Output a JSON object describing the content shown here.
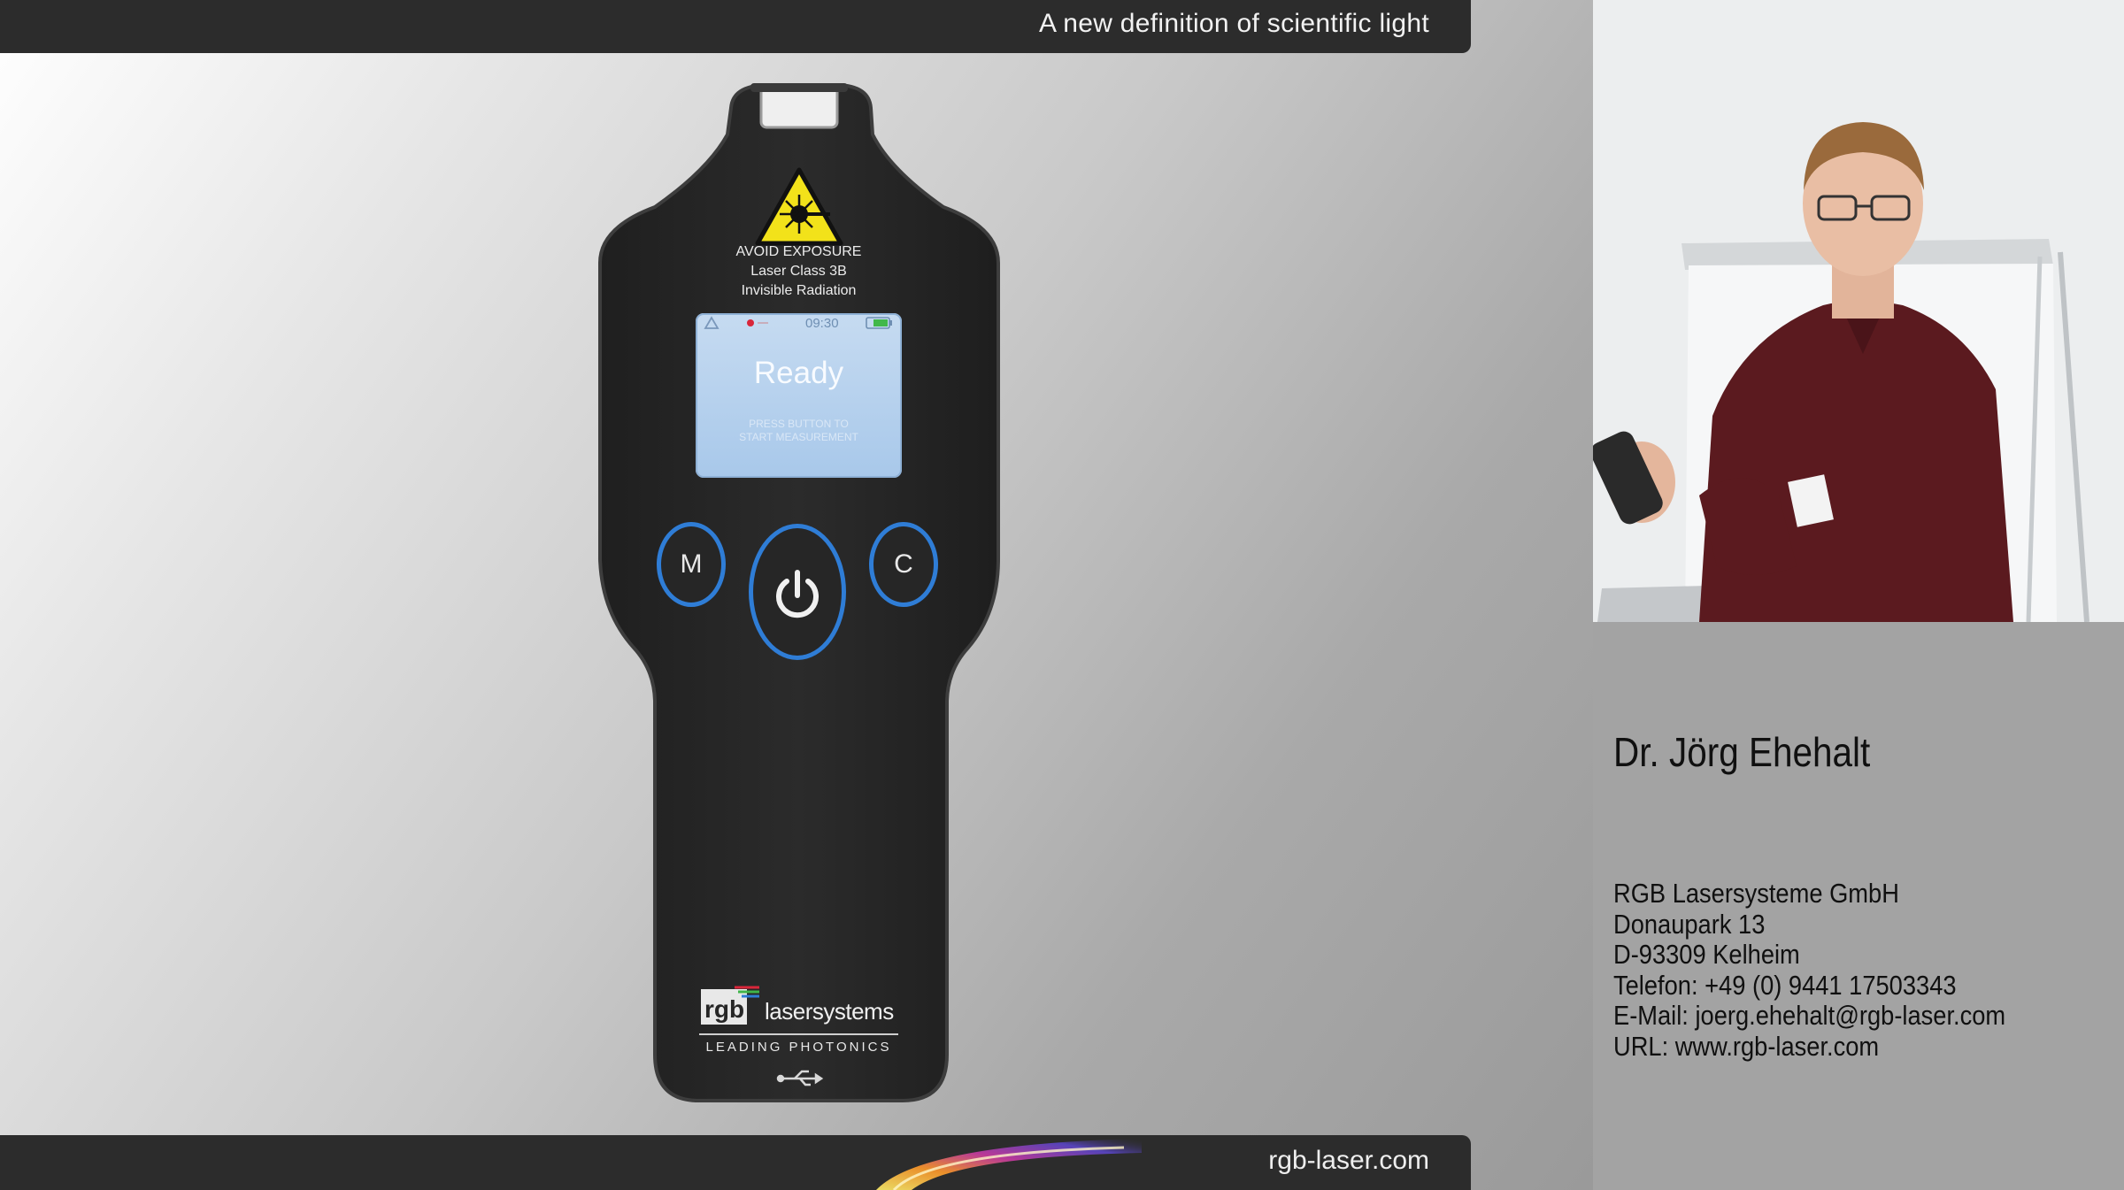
{
  "slide": {
    "tagline": "A new definition of scientific light",
    "footer_url": "rgb-laser.com"
  },
  "device": {
    "warning": {
      "line1": "AVOID EXPOSURE",
      "line2": "Laser Class 3B",
      "line3": "Invisible Radiation"
    },
    "screen": {
      "time": "09:30",
      "status": "Ready",
      "instruction_line1": "PRESS BUTTON TO",
      "instruction_line2": "START MEASUREMENT"
    },
    "buttons": {
      "mode_label": "M",
      "clear_label": "C",
      "power_icon": "power-icon"
    },
    "brand": {
      "logo_mark": "rgb",
      "name": "lasersystems",
      "slogan": "LEADING PHOTONICS"
    },
    "port_icon": "usb-icon"
  },
  "speaker": {
    "name": "Dr. Jörg Ehehalt",
    "company": "RGB Lasersysteme GmbH",
    "street": "Donaupark 13",
    "city": "D-93309 Kelheim",
    "phone": "Telefon: +49 (0) 9441 17503343",
    "email": "E-Mail: joerg.ehehalt@rgb-laser.com",
    "url": "URL: www.rgb-laser.com"
  },
  "colors": {
    "bar": "#2c2c2c",
    "device_body": "#262626",
    "button_ring": "#2f7dd6",
    "screen": "#b3cfee",
    "warning_yellow": "#f2e21a",
    "info_panel": "#a3a3a3",
    "shirt": "#5b1a1f"
  }
}
